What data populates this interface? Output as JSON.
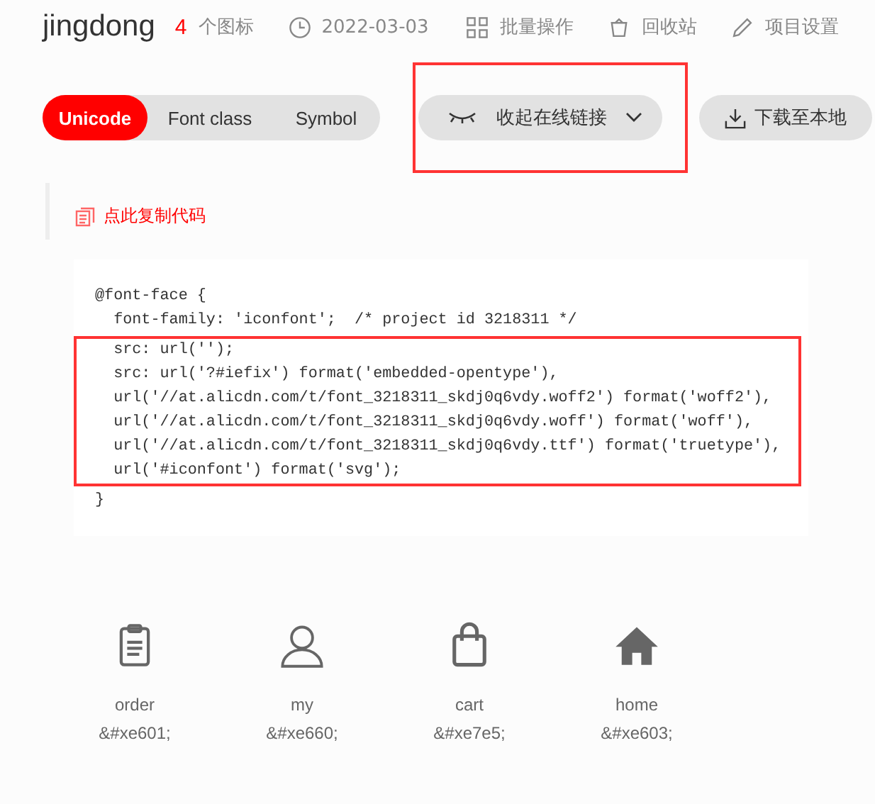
{
  "header": {
    "title": "jingdong",
    "icon_count": "4",
    "icon_count_label": "个图标",
    "date": "2022-03-03",
    "actions": [
      {
        "kind": "batch",
        "label": "批量操作"
      },
      {
        "kind": "trash",
        "label": "回收站"
      },
      {
        "kind": "edit",
        "label": "项目设置"
      }
    ]
  },
  "tabs": [
    {
      "label": "Unicode",
      "selected": true
    },
    {
      "label": "Font class",
      "selected": false
    },
    {
      "label": "Symbol",
      "selected": false
    }
  ],
  "link_toggle": {
    "label": "收起在线链接",
    "highlighted": true
  },
  "download": {
    "label": "下载至本地"
  },
  "copy_link": "点此复制代码",
  "code": [
    {
      "text": "@font-face {",
      "highlighted": false
    },
    {
      "text": "  font-family: 'iconfont';  /* project id 3218311 */",
      "highlighted": false
    },
    {
      "text": "  src: url('');",
      "highlighted": true
    },
    {
      "text": "  src: url('?#iefix') format('embedded-opentype'),",
      "highlighted": true
    },
    {
      "text": "  url('//at.alicdn.com/t/font_3218311_skdj0q6vdy.woff2') format('woff2'),",
      "highlighted": true
    },
    {
      "text": "  url('//at.alicdn.com/t/font_3218311_skdj0q6vdy.woff') format('woff'),",
      "highlighted": true
    },
    {
      "text": "  url('//at.alicdn.com/t/font_3218311_skdj0q6vdy.ttf') format('truetype'),",
      "highlighted": true
    },
    {
      "text": "  url('#iconfont') format('svg');",
      "highlighted": true
    },
    {
      "text": "}",
      "highlighted": false
    }
  ],
  "icons": [
    {
      "kind": "clipboard",
      "name": "order",
      "code": "&#xe601;"
    },
    {
      "kind": "person",
      "name": "my",
      "code": "&#xe660;"
    },
    {
      "kind": "bag",
      "name": "cart",
      "code": "&#xe7e5;"
    },
    {
      "kind": "house",
      "name": "home",
      "code": "&#xe603;"
    }
  ]
}
